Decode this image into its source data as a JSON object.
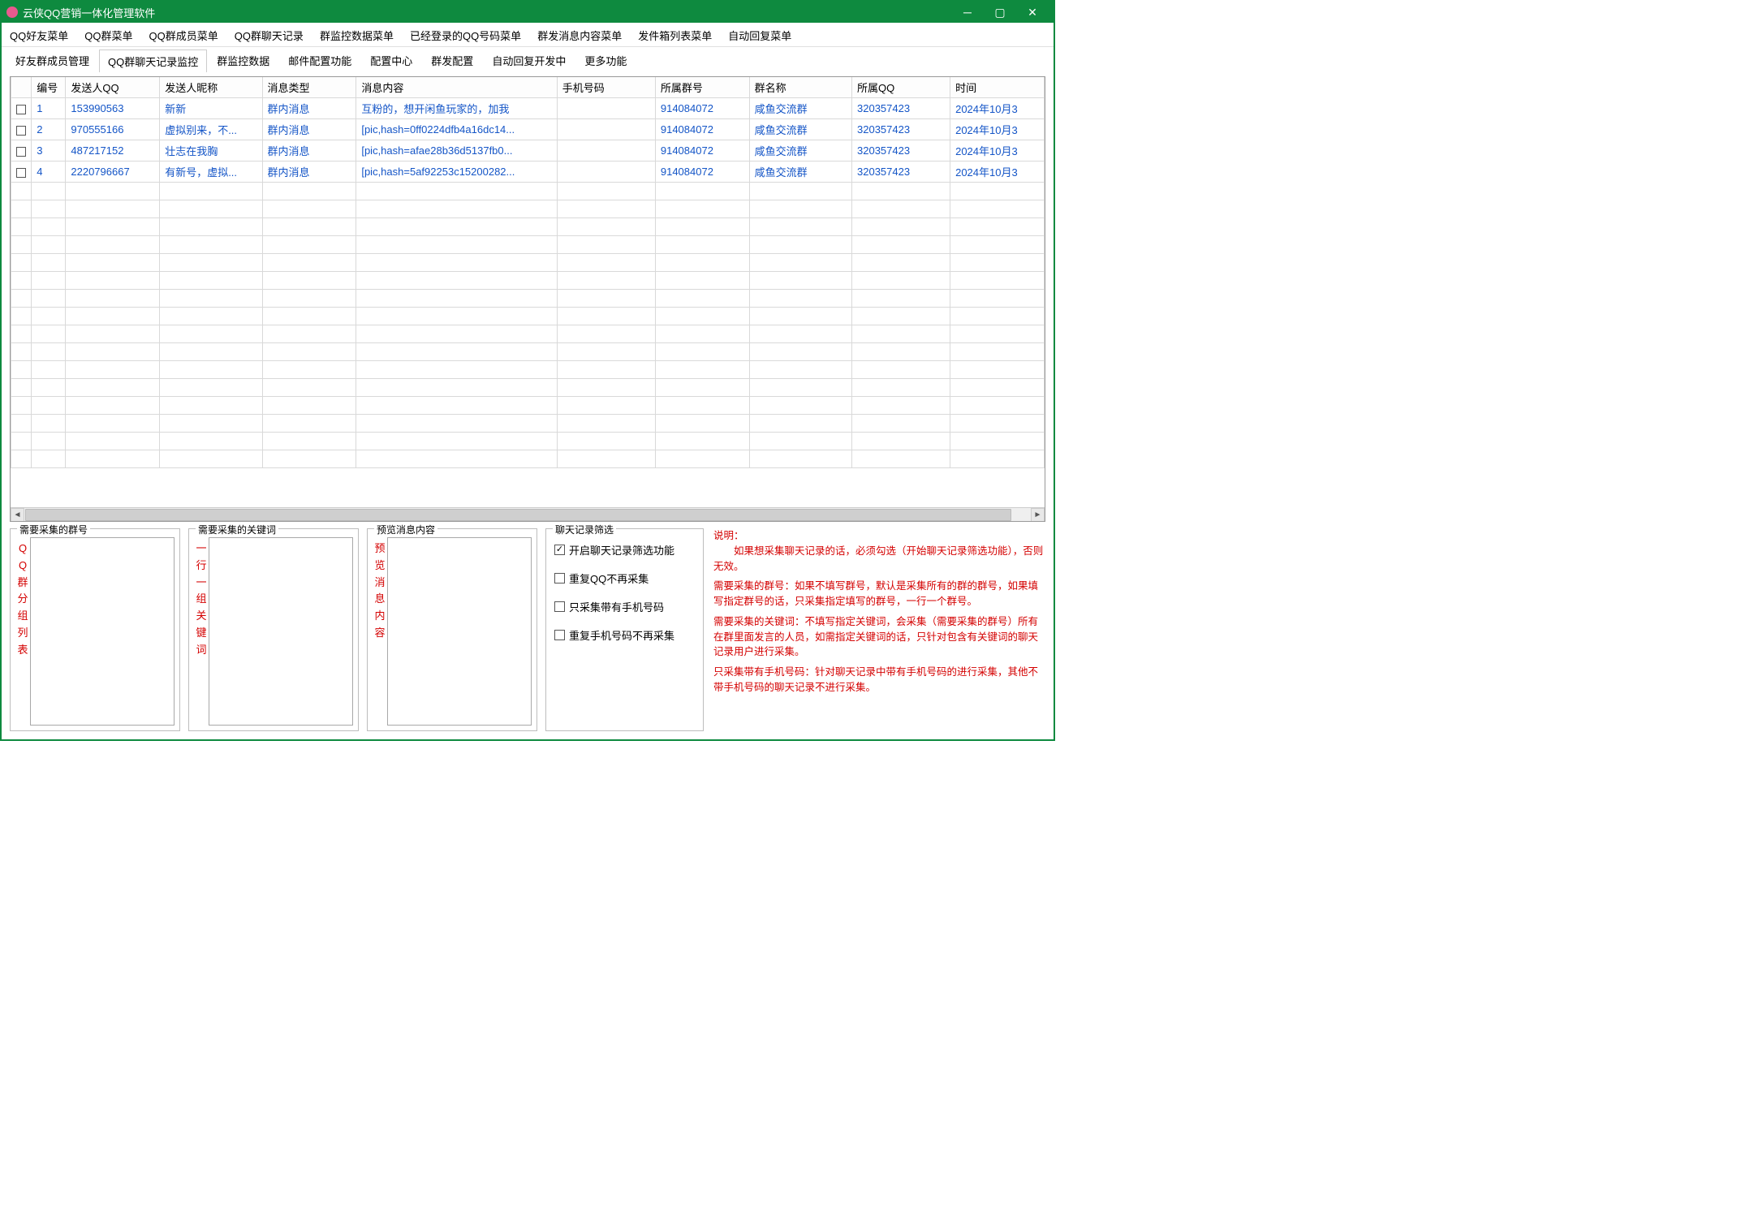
{
  "window": {
    "title": "云侠QQ营销一体化管理软件"
  },
  "menubar": [
    "QQ好友菜单",
    "QQ群菜单",
    "QQ群成员菜单",
    "QQ群聊天记录",
    "群监控数据菜单",
    "已经登录的QQ号码菜单",
    "群发消息内容菜单",
    "发件箱列表菜单",
    "自动回复菜单"
  ],
  "tabs": [
    {
      "label": "好友群成员管理",
      "active": false
    },
    {
      "label": "QQ群聊天记录监控",
      "active": true
    },
    {
      "label": "群监控数据",
      "active": false
    },
    {
      "label": "邮件配置功能",
      "active": false
    },
    {
      "label": "配置中心",
      "active": false
    },
    {
      "label": "群发配置",
      "active": false
    },
    {
      "label": "自动回复开发中",
      "active": false
    },
    {
      "label": "更多功能",
      "active": false
    }
  ],
  "columns": [
    "编号",
    "发送人QQ",
    "发送人昵称",
    "消息类型",
    "消息内容",
    "手机号码",
    "所属群号",
    "群名称",
    "所属QQ",
    "时间"
  ],
  "rows": [
    {
      "id": "1",
      "qq": "153990563",
      "nick": "新新",
      "type": "群内消息",
      "msg": "互粉的，想开闲鱼玩家的，加我",
      "phone": "",
      "grpid": "914084072",
      "grpname": "咸鱼交流群",
      "ownqq": "320357423",
      "time": "2024年10月3"
    },
    {
      "id": "2",
      "qq": "970555166",
      "nick": "虚拟别来，不...",
      "type": "群内消息",
      "msg": "[pic,hash=0ff0224dfb4a16dc14...",
      "phone": "",
      "grpid": "914084072",
      "grpname": "咸鱼交流群",
      "ownqq": "320357423",
      "time": "2024年10月3"
    },
    {
      "id": "3",
      "qq": "487217152",
      "nick": "壮志在我胸",
      "type": "群内消息",
      "msg": "[pic,hash=afae28b36d5137fb0...",
      "phone": "",
      "grpid": "914084072",
      "grpname": "咸鱼交流群",
      "ownqq": "320357423",
      "time": "2024年10月3"
    },
    {
      "id": "4",
      "qq": "2220796667",
      "nick": "有新号，虚拟...",
      "type": "群内消息",
      "msg": "[pic,hash=5af92253c15200282...",
      "phone": "",
      "grpid": "914084072",
      "grpname": "咸鱼交流群",
      "ownqq": "320357423",
      "time": "2024年10月3"
    }
  ],
  "panels": {
    "p1": {
      "legend": "需要采集的群号",
      "vlabel": "QQ群分组列表"
    },
    "p2": {
      "legend": "需要采集的关键词",
      "vlabel": "一行一组关键词"
    },
    "p3": {
      "legend": "预览消息内容",
      "vlabel": "预览消息内容"
    },
    "p4": {
      "legend": "聊天记录筛选",
      "options": [
        {
          "label": "开启聊天记录筛选功能",
          "checked": true
        },
        {
          "label": "重复QQ不再采集",
          "checked": false
        },
        {
          "label": "只采集带有手机号码",
          "checked": false
        },
        {
          "label": "重复手机号码不再采集",
          "checked": false
        }
      ]
    }
  },
  "description": {
    "heading": "说明：",
    "p1": "　　如果想采集聊天记录的话，必须勾选（开始聊天记录筛选功能），否则无效。",
    "p2": "需要采集的群号：如果不填写群号，默认是采集所有的群的群号，如果填写指定群号的话，只采集指定填写的群号，一行一个群号。",
    "p3": "需要采集的关键词：不填写指定关键词，会采集（需要采集的群号）所有在群里面发言的人员，如需指定关键词的话，只针对包含有关键词的聊天记录用户进行采集。",
    "p4": "只采集带有手机号码：针对聊天记录中带有手机号码的进行采集，其他不带手机号码的聊天记录不进行采集。"
  }
}
